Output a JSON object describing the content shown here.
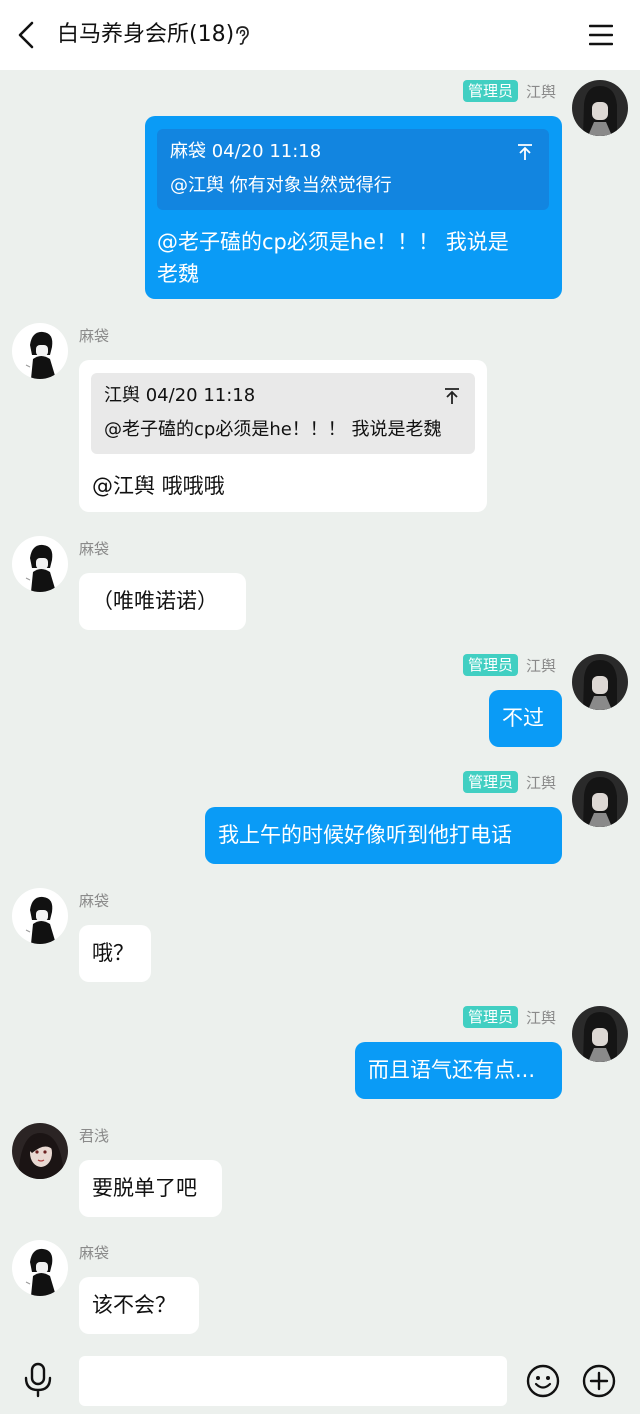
{
  "header": {
    "title": "白马养身会所(18)"
  },
  "badge": "管理员",
  "messages": [
    {
      "sender": "江舆",
      "quote": {
        "head": "麻袋 04/20 11:18",
        "text": "@江舆 你有对象当然觉得行"
      },
      "lines": [
        "@老子磕的cp必须是he！！！ 我说是",
        "老魏"
      ]
    },
    {
      "sender": "麻袋",
      "quote": {
        "head": "江舆 04/20 11:18",
        "text": "@老子磕的cp必须是he！！！ 我说是老魏"
      },
      "text": "@江舆 哦哦哦"
    },
    {
      "sender": "麻袋",
      "text": "（唯唯诺诺）"
    },
    {
      "sender": "江舆",
      "text": "不过"
    },
    {
      "sender": "江舆",
      "text": "我上午的时候好像听到他打电话"
    },
    {
      "sender": "麻袋",
      "text": "哦？"
    },
    {
      "sender": "江舆",
      "text": "而且语气还有点..."
    },
    {
      "sender": "君浅",
      "text": "要脱单了吧"
    },
    {
      "sender": "麻袋",
      "text": "该不会？"
    }
  ],
  "input": {
    "placeholder": ""
  },
  "colors": {
    "outgoing_bubble": "#0a9bf6",
    "incoming_bubble": "#ffffff",
    "admin_badge": "#41cfc2",
    "background": "#ecf0ed"
  },
  "icons": [
    "back-icon",
    "ear-icon",
    "menu-icon",
    "avatar",
    "mic-icon",
    "emoji-icon",
    "plus-icon"
  ]
}
